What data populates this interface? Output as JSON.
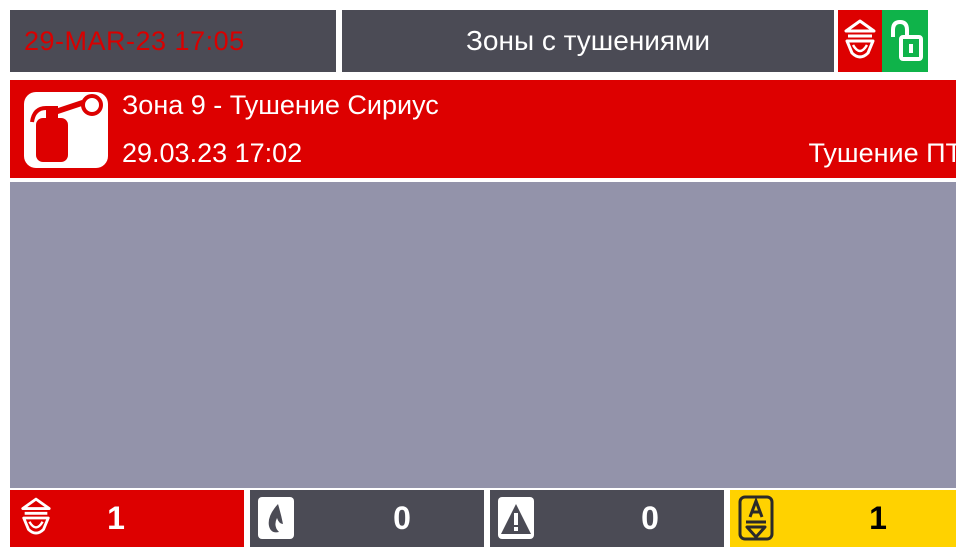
{
  "header": {
    "datetime": "29-MAR-23  17:05",
    "title": "Зоны с тушениями",
    "alarm_icon": "fire-alarm-icon",
    "lock_icon": "unlocked-icon",
    "colors": {
      "panel": "#4b4b55",
      "date_text": "#d80000",
      "alarm_bg": "#dd0000",
      "lock_bg": "#0fb34a"
    }
  },
  "events": [
    {
      "icon": "fire-extinguisher-icon",
      "zone": "Зона 9 - Тушение Сириус",
      "time": "29.03.23 17:02",
      "status": "Тушение ПТ",
      "color": "#dd0000"
    }
  ],
  "counters": [
    {
      "icon": "fire-alarm-icon",
      "value": "1",
      "color": "#dd0000"
    },
    {
      "icon": "flame-icon",
      "value": "0",
      "color": "#4b4b55"
    },
    {
      "icon": "warning-icon",
      "value": "0",
      "color": "#4b4b55"
    },
    {
      "icon": "automation-icon",
      "value": "1",
      "color": "#ffd200"
    }
  ]
}
